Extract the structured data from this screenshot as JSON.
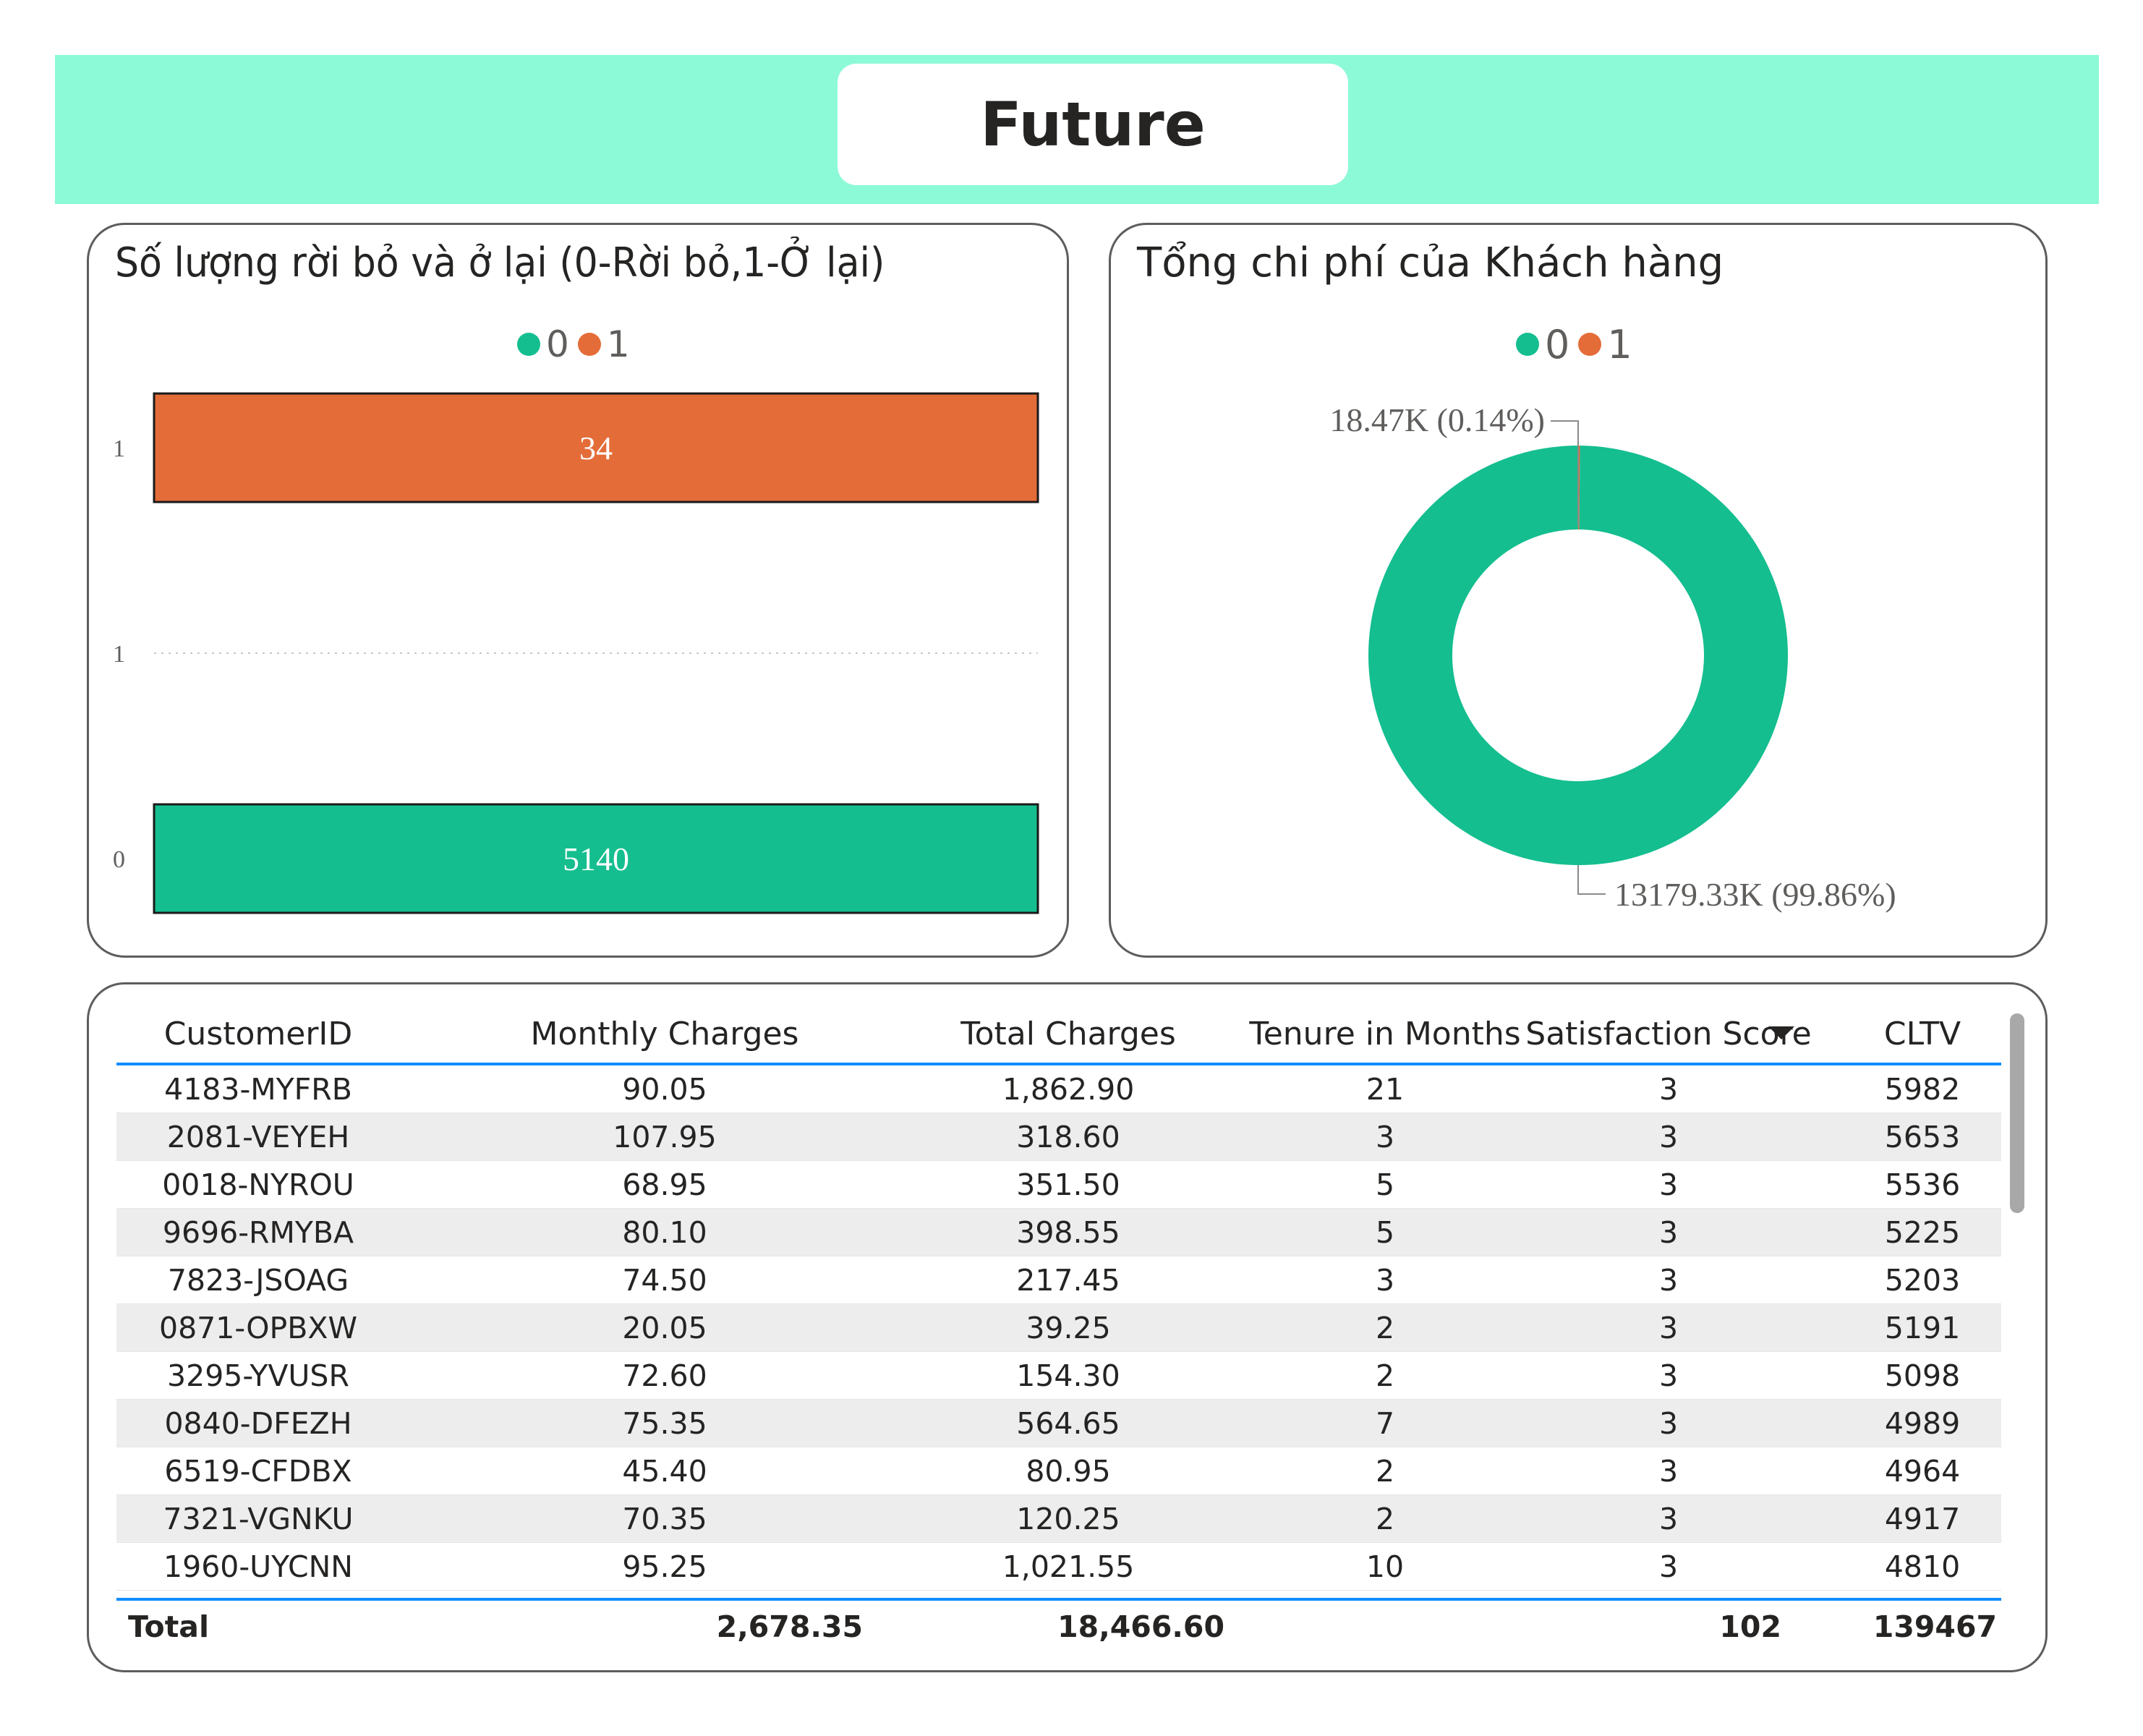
{
  "header": {
    "title": "Future"
  },
  "colors": {
    "band": "#8cf9d7",
    "series0": "#14be8f",
    "series1": "#e46c39",
    "accent_line": "#118dff"
  },
  "bar_card": {
    "title": "Số lượng rời bỏ và ở lại (0-Rời bỏ,1-Ở lại)"
  },
  "donut_card": {
    "title": "Tổng chi phí của Khách hàng"
  },
  "chart_data": [
    {
      "type": "bar",
      "orientation": "horizontal",
      "title": "Số lượng rời bỏ và ở lại (0-Rời bỏ,1-Ở lại)",
      "legend": [
        "0",
        "1"
      ],
      "legend_position": "top-center",
      "categories": [
        "1",
        "0"
      ],
      "y_tick_labels": [
        "1",
        "1",
        "0"
      ],
      "series": [
        {
          "name": "1",
          "category": "1",
          "value": 34,
          "label": "34",
          "color": "#e46c39"
        },
        {
          "name": "0",
          "category": "0",
          "value": 5140,
          "label": "5140",
          "color": "#14be8f"
        }
      ],
      "xlabel": "",
      "ylabel": ""
    },
    {
      "type": "pie",
      "variant": "donut",
      "title": "Tổng chi phí của Khách hàng",
      "legend": [
        "0",
        "1"
      ],
      "legend_position": "top-center",
      "slices": [
        {
          "name": "1",
          "value": 18.47,
          "percent": 0.14,
          "label": "18.47K (0.14%)",
          "color": "#e46c39"
        },
        {
          "name": "0",
          "value": 13179.33,
          "percent": 99.86,
          "label": "13179.33K (99.86%)",
          "color": "#14be8f"
        }
      ]
    },
    {
      "type": "table",
      "columns": [
        "CustomerID",
        "Monthly Charges",
        "Total Charges",
        "Tenure in Months",
        "Satisfaction Score",
        "CLTV"
      ],
      "sorted_column": "Satisfaction Score",
      "rows": [
        [
          "4183-MYFRB",
          "90.05",
          "1,862.90",
          "21",
          "3",
          "5982"
        ],
        [
          "2081-VEYEH",
          "107.95",
          "318.60",
          "3",
          "3",
          "5653"
        ],
        [
          "0018-NYROU",
          "68.95",
          "351.50",
          "5",
          "3",
          "5536"
        ],
        [
          "9696-RMYBA",
          "80.10",
          "398.55",
          "5",
          "3",
          "5225"
        ],
        [
          "7823-JSOAG",
          "74.50",
          "217.45",
          "3",
          "3",
          "5203"
        ],
        [
          "0871-OPBXW",
          "20.05",
          "39.25",
          "2",
          "3",
          "5191"
        ],
        [
          "3295-YVUSR",
          "72.60",
          "154.30",
          "2",
          "3",
          "5098"
        ],
        [
          "0840-DFEZH",
          "75.35",
          "564.65",
          "7",
          "3",
          "4989"
        ],
        [
          "6519-CFDBX",
          "45.40",
          "80.95",
          "2",
          "3",
          "4964"
        ],
        [
          "7321-VGNKU",
          "70.35",
          "120.25",
          "2",
          "3",
          "4917"
        ],
        [
          "1960-UYCNN",
          "95.25",
          "1,021.55",
          "10",
          "3",
          "4810"
        ]
      ],
      "total": {
        "label": "Total",
        "monthly_charges": "2,678.35",
        "total_charges": "18,466.60",
        "satisfaction_score": "102",
        "cltv": "139467"
      }
    }
  ]
}
